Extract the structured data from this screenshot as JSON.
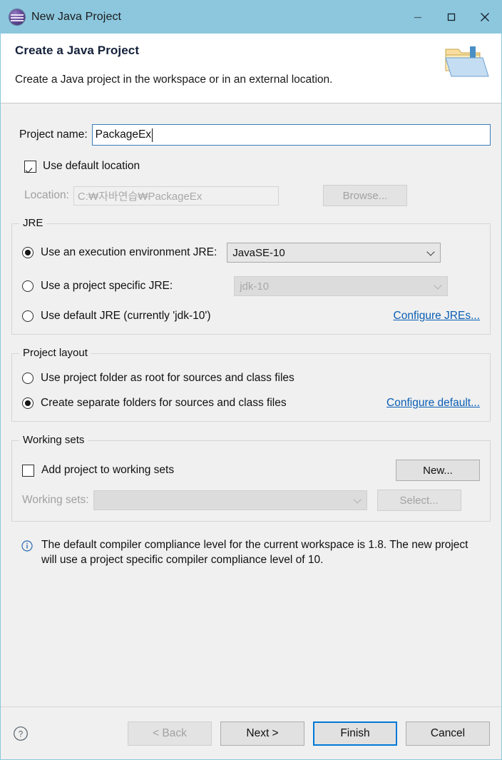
{
  "window": {
    "title": "New Java Project",
    "icon": "eclipse-icon",
    "controls": {
      "minimize": "minimize-icon",
      "maximize": "maximize-icon",
      "close": "close-icon"
    }
  },
  "header": {
    "title": "Create a Java Project",
    "subtitle": "Create a Java project in the workspace or in an external location.",
    "icon": "java-project-folder-icon"
  },
  "project": {
    "name_label": "Project name:",
    "name_value": "PackageEx",
    "use_default_location_label": "Use default location",
    "use_default_location_checked": true,
    "location_label": "Location:",
    "location_value": "C:₩자바연습₩PackageEx",
    "browse_label": "Browse..."
  },
  "jre": {
    "legend": "JRE",
    "options": [
      {
        "label": "Use an execution environment JRE:",
        "selected": true
      },
      {
        "label": "Use a project specific JRE:",
        "selected": false
      },
      {
        "label": "Use default JRE (currently 'jdk-10')",
        "selected": false
      }
    ],
    "execution_environment_value": "JavaSE-10",
    "project_specific_value": "jdk-10",
    "configure_link": "Configure JREs..."
  },
  "project_layout": {
    "legend": "Project layout",
    "options": [
      {
        "label": "Use project folder as root for sources and class files",
        "selected": false
      },
      {
        "label": "Create separate folders for sources and class files",
        "selected": true
      }
    ],
    "configure_link": "Configure default..."
  },
  "working_sets": {
    "legend": "Working sets",
    "add_label": "Add project to working sets",
    "add_checked": false,
    "new_label": "New...",
    "sets_label": "Working sets:",
    "sets_value": "",
    "select_label": "Select..."
  },
  "message": {
    "icon": "info-icon",
    "text": "The default compiler compliance level for the current workspace is 1.8. The new project will use a project specific compiler compliance level of 10."
  },
  "footer": {
    "help_icon": "help-icon",
    "buttons": [
      {
        "label": "< Back",
        "enabled": false,
        "primary": false
      },
      {
        "label": "Next >",
        "enabled": true,
        "primary": false
      },
      {
        "label": "Finish",
        "enabled": true,
        "primary": true
      },
      {
        "label": "Cancel",
        "enabled": true,
        "primary": false
      }
    ]
  },
  "colors": {
    "titlebar": "#8cc7de",
    "accent": "#0078d7",
    "link": "#0a5eb4",
    "surface": "#f0f0f0"
  }
}
